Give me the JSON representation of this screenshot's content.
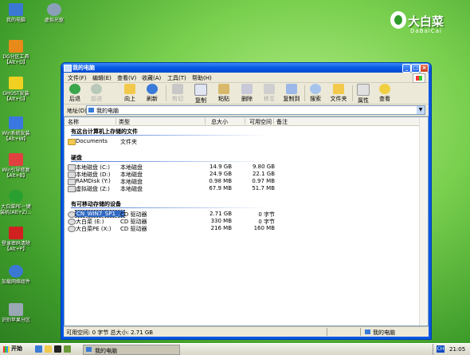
{
  "desktop": {
    "icons": [
      {
        "label": "我的电脑",
        "icon": "computer-icon",
        "color": "#3a78d4"
      },
      {
        "label": "虚拟光驱",
        "icon": "cd-drive-icon",
        "color": "#8aa0b8"
      },
      {
        "label": "DG分区工具【Alt+D】",
        "icon": "dg-partition-icon",
        "color": "#e88a1a"
      },
      {
        "label": "GHOST安装【Alt+G】",
        "icon": "ghost-icon",
        "color": "#f0d020"
      },
      {
        "label": "Win系统安装【Alt+W】",
        "icon": "windows-install-icon",
        "color": "#3b77e0"
      },
      {
        "label": "Win引导修复【Alt+B】",
        "icon": "boot-repair-icon",
        "color": "#e04040"
      },
      {
        "label": "大白菜PE一键装机(Alt+Z)...",
        "icon": "onekey-install-icon",
        "color": "#2aa030"
      },
      {
        "label": "登录密码清除【Alt+P】",
        "icon": "password-clear-icon",
        "color": "#d02020"
      },
      {
        "label": "加载网络组件",
        "icon": "network-icon",
        "color": "#3a78d4"
      },
      {
        "label": "识别苹果分区",
        "icon": "apple-partition-icon",
        "color": "#9aa7b4"
      }
    ],
    "logo": {
      "text": "大白菜",
      "sub": "DaBaiCai"
    }
  },
  "window": {
    "title": "我的电脑",
    "menu": [
      "文件(F)",
      "编辑(E)",
      "查看(V)",
      "收藏(A)",
      "工具(T)",
      "帮助(H)"
    ],
    "toolbar": [
      {
        "label": "后退",
        "icon": "back-arrow-icon",
        "disabled": false
      },
      {
        "label": "前进",
        "icon": "forward-arrow-icon",
        "disabled": true
      },
      {
        "label": "向上",
        "icon": "up-folder-icon",
        "disabled": false
      },
      {
        "label": "刷新",
        "icon": "refresh-icon",
        "disabled": false
      },
      {
        "label": "剪切",
        "icon": "cut-icon",
        "disabled": true
      },
      {
        "label": "复制",
        "icon": "copy-icon",
        "disabled": false
      },
      {
        "label": "粘贴",
        "icon": "paste-icon",
        "disabled": false
      },
      {
        "label": "删除",
        "icon": "delete-icon",
        "disabled": false
      },
      {
        "label": "移至",
        "icon": "move-to-icon",
        "disabled": true
      },
      {
        "label": "复制到",
        "icon": "copy-to-icon",
        "disabled": false
      },
      {
        "label": "搜索",
        "icon": "search-icon",
        "disabled": false
      },
      {
        "label": "文件夹",
        "icon": "folders-icon",
        "disabled": false
      },
      {
        "label": "属性",
        "icon": "properties-icon",
        "disabled": false
      },
      {
        "label": "查看",
        "icon": "views-icon",
        "disabled": false
      }
    ],
    "address": {
      "label": "地址(D)",
      "value": "我的电脑"
    },
    "columns": [
      "名称",
      "类型",
      "总大小",
      "可用空间",
      "备注"
    ],
    "groups": [
      {
        "title": "有这台计算机上存储的文件",
        "rows": [
          {
            "name": "Documents",
            "type": "文件夹",
            "size": "",
            "free": ""
          }
        ]
      },
      {
        "title": "硬盘",
        "rows": [
          {
            "name": "本地磁盘 (C:)",
            "type": "本地磁盘",
            "size": "14.9 GB",
            "free": "9.80 GB"
          },
          {
            "name": "本地磁盘 (D:)",
            "type": "本地磁盘",
            "size": "24.9 GB",
            "free": "22.1 GB"
          },
          {
            "name": "RAMDisk (Y:)",
            "type": "本地磁盘",
            "size": "0.98 MB",
            "free": "0.97 MB"
          },
          {
            "name": "虚拟磁盘 (Z:)",
            "type": "本地磁盘",
            "size": "67.9 MB",
            "free": "51.7 MB"
          }
        ]
      },
      {
        "title": "有可移动存储的设备",
        "rows": [
          {
            "name": "CN_WIN7_SP1_...",
            "type": "CD 驱动器",
            "size": "2.71 GB",
            "free": "0 字节",
            "selected": true
          },
          {
            "name": "大白菜 (E:)",
            "type": "CD 驱动器",
            "size": "330 MB",
            "free": "0 字节"
          },
          {
            "name": "大白菜PE (X:)",
            "type": "CD 驱动器",
            "size": "216 MB",
            "free": "160 MB"
          }
        ]
      }
    ],
    "status": {
      "left": "可用空间: 0 字节 总大小: 2.71 GB",
      "right": "我的电脑"
    }
  },
  "taskbar": {
    "start": "开始",
    "task": "我的电脑",
    "lang": "CH",
    "clock": "21:05"
  }
}
